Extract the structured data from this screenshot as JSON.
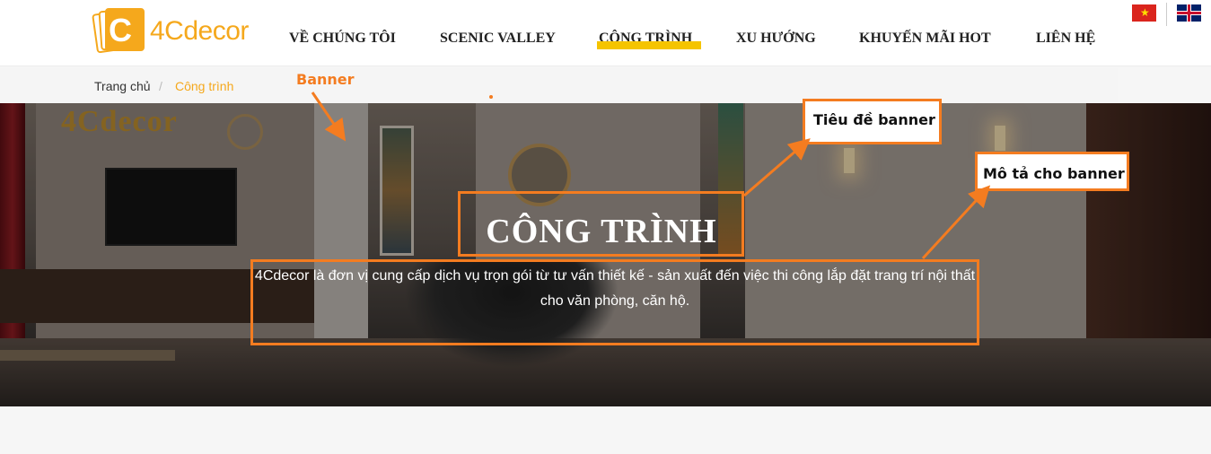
{
  "brand": {
    "logo_letter": "C",
    "logo_text": "4Cdecor",
    "accent": "#f5a81c"
  },
  "nav": {
    "items": [
      {
        "label": "VỀ CHÚNG TÔI"
      },
      {
        "label": "SCENIC VALLEY"
      },
      {
        "label": "CÔNG TRÌNH"
      },
      {
        "label": "XU HƯỚNG"
      },
      {
        "label": "KHUYẾN MÃI HOT"
      },
      {
        "label": "LIÊN HỆ"
      }
    ],
    "active_index": 2,
    "active_color": "#f5c400"
  },
  "languages": [
    {
      "code": "vi",
      "icon": "vietnam-flag-icon"
    },
    {
      "code": "en",
      "icon": "uk-flag-icon"
    }
  ],
  "breadcrumb": {
    "home": "Trang chủ",
    "separator": "/",
    "current": "Công trình"
  },
  "banner": {
    "watermark": "4Cdecor",
    "title": "CÔNG TRÌNH",
    "description": "4Cdecor là đơn vị cung cấp dịch vụ trọn gói từ tư vấn thiết kế - sản xuất đến việc thi công lắp đặt trang trí nội thất cho văn phòng, căn hộ."
  },
  "annotations": {
    "banner_label": "Banner",
    "title_label": "Tiêu đề banner",
    "desc_label": "Mô tả cho banner",
    "color": "#f47c20"
  }
}
